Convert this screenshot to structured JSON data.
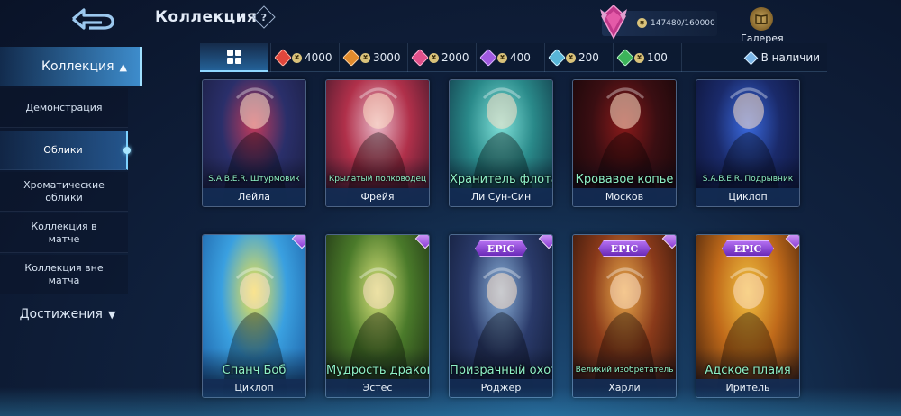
{
  "header": {
    "title": "Коллекция",
    "help": "?",
    "points": "147480/160000",
    "gallery_label": "Галерея"
  },
  "sidebar": {
    "main_label": "Коллекция",
    "items": [
      {
        "label": "Демонстрация",
        "active": false
      },
      {
        "label": "Облики",
        "active": true
      },
      {
        "label": "Хроматические облики",
        "active": false
      },
      {
        "label": "Коллекция в матче",
        "active": false
      },
      {
        "label": "Коллекция вне матча",
        "active": false
      }
    ],
    "achievements_label": "Достижения"
  },
  "filters": {
    "tiers": [
      {
        "value": "4000",
        "color": "#e0463c"
      },
      {
        "value": "3000",
        "color": "#e08a2c"
      },
      {
        "value": "2000",
        "color": "#e0508a"
      },
      {
        "value": "400",
        "color": "#a05ae0"
      },
      {
        "value": "200",
        "color": "#58b6d8"
      },
      {
        "value": "100",
        "color": "#3cb45a"
      }
    ],
    "available_label": "В наличии"
  },
  "cards": [
    {
      "skin": "S.A.B.E.R. Штурмовик",
      "hero": "Лейла",
      "epic": false,
      "colors": [
        "#c43a5a",
        "#2a2f6a",
        "#1a1d3e"
      ]
    },
    {
      "skin": "Крылатый полководец",
      "hero": "Фрейя",
      "epic": false,
      "colors": [
        "#e8b8c8",
        "#b0304a",
        "#3a1628"
      ]
    },
    {
      "skin": "Хранитель флота",
      "hero": "Ли Сун-Син",
      "epic": false,
      "colors": [
        "#7fe0d8",
        "#2a8a8a",
        "#0e3040"
      ]
    },
    {
      "skin": "Кровавое копье",
      "hero": "Москов",
      "epic": false,
      "colors": [
        "#8a1a1a",
        "#3a0e12",
        "#120608"
      ]
    },
    {
      "skin": "S.A.B.E.R. Подрывник",
      "hero": "Циклоп",
      "epic": false,
      "colors": [
        "#3a6ae0",
        "#1a2a6a",
        "#0c1232"
      ]
    },
    {
      "skin": "Спанч Боб",
      "hero": "Циклоп",
      "epic": false,
      "colors": [
        "#f4e64a",
        "#3aa0e0",
        "#1a5aa0"
      ]
    },
    {
      "skin": "Мудрость дракона",
      "hero": "Эстес",
      "epic": false,
      "colors": [
        "#d8e27a",
        "#4a7a2a",
        "#1a2a12"
      ]
    },
    {
      "skin": "Призрачный охотник",
      "hero": "Роджер",
      "epic": true,
      "epic_label": "EPIC",
      "colors": [
        "#8ab0d8",
        "#2a3a6a",
        "#101a34"
      ]
    },
    {
      "skin": "Великий изобретатель",
      "hero": "Харли",
      "epic": true,
      "epic_label": "EPIC",
      "colors": [
        "#e8a84a",
        "#8a3a1a",
        "#2a120a"
      ]
    },
    {
      "skin": "Адское пламя",
      "hero": "Иритель",
      "epic": true,
      "epic_label": "EPIC",
      "colors": [
        "#f0c040",
        "#c06a1a",
        "#3a1a0a"
      ]
    }
  ]
}
